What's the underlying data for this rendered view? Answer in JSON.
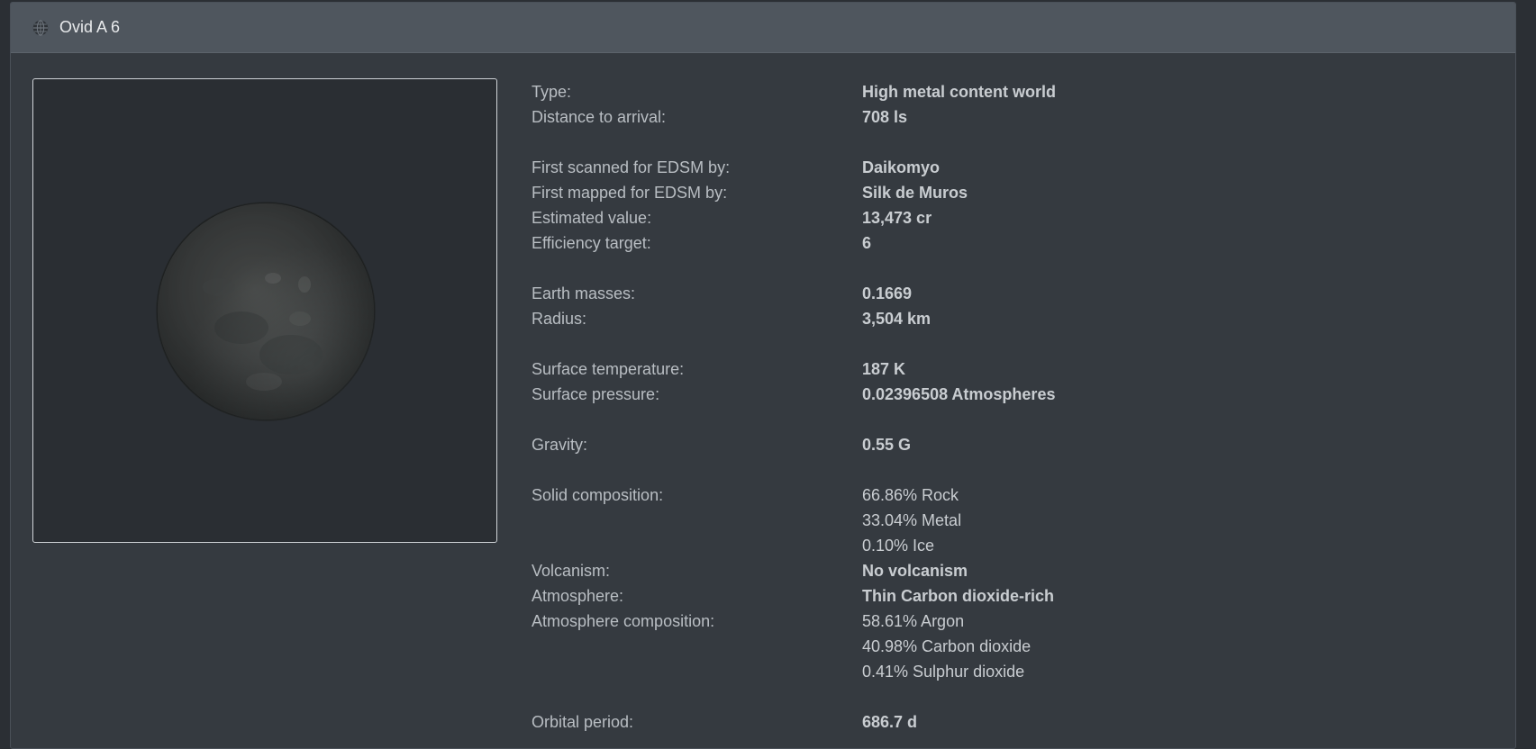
{
  "header": {
    "title": "Ovid A 6",
    "icon": "globe-icon"
  },
  "image": {
    "icon": "planet-image"
  },
  "groups": [
    [
      {
        "label": "Type:",
        "values": [
          "High metal content world"
        ],
        "bold": true
      },
      {
        "label": "Distance to arrival:",
        "values": [
          "708 ls"
        ],
        "bold": true
      }
    ],
    [
      {
        "label": "First scanned for EDSM by:",
        "values": [
          "Daikomyo"
        ],
        "bold": true
      },
      {
        "label": "First mapped for EDSM by:",
        "values": [
          "Silk de Muros"
        ],
        "bold": true
      },
      {
        "label": "Estimated value:",
        "values": [
          "13,473 cr"
        ],
        "bold": true
      },
      {
        "label": "Efficiency target:",
        "values": [
          "6"
        ],
        "bold": true
      }
    ],
    [
      {
        "label": "Earth masses:",
        "values": [
          "0.1669"
        ],
        "bold": true
      },
      {
        "label": "Radius:",
        "values": [
          "3,504 km"
        ],
        "bold": true
      }
    ],
    [
      {
        "label": "Surface temperature:",
        "values": [
          "187 K"
        ],
        "bold": true
      },
      {
        "label": "Surface pressure:",
        "values": [
          "0.02396508 Atmospheres"
        ],
        "bold": true
      }
    ],
    [
      {
        "label": "Gravity:",
        "values": [
          "0.55 G"
        ],
        "bold": true
      }
    ],
    [
      {
        "label": "Solid composition:",
        "values": [
          "66.86% Rock",
          "33.04% Metal",
          "0.10% Ice"
        ],
        "bold": false
      },
      {
        "label": "Volcanism:",
        "values": [
          "No volcanism"
        ],
        "bold": true
      },
      {
        "label": "Atmosphere:",
        "values": [
          "Thin Carbon dioxide-rich"
        ],
        "bold": true
      },
      {
        "label": "Atmosphere composition:",
        "values": [
          "58.61% Argon",
          "40.98% Carbon dioxide",
          "0.41% Sulphur dioxide"
        ],
        "bold": false
      }
    ],
    [
      {
        "label": "Orbital period:",
        "values": [
          "686.7 d"
        ],
        "bold": true
      }
    ]
  ]
}
